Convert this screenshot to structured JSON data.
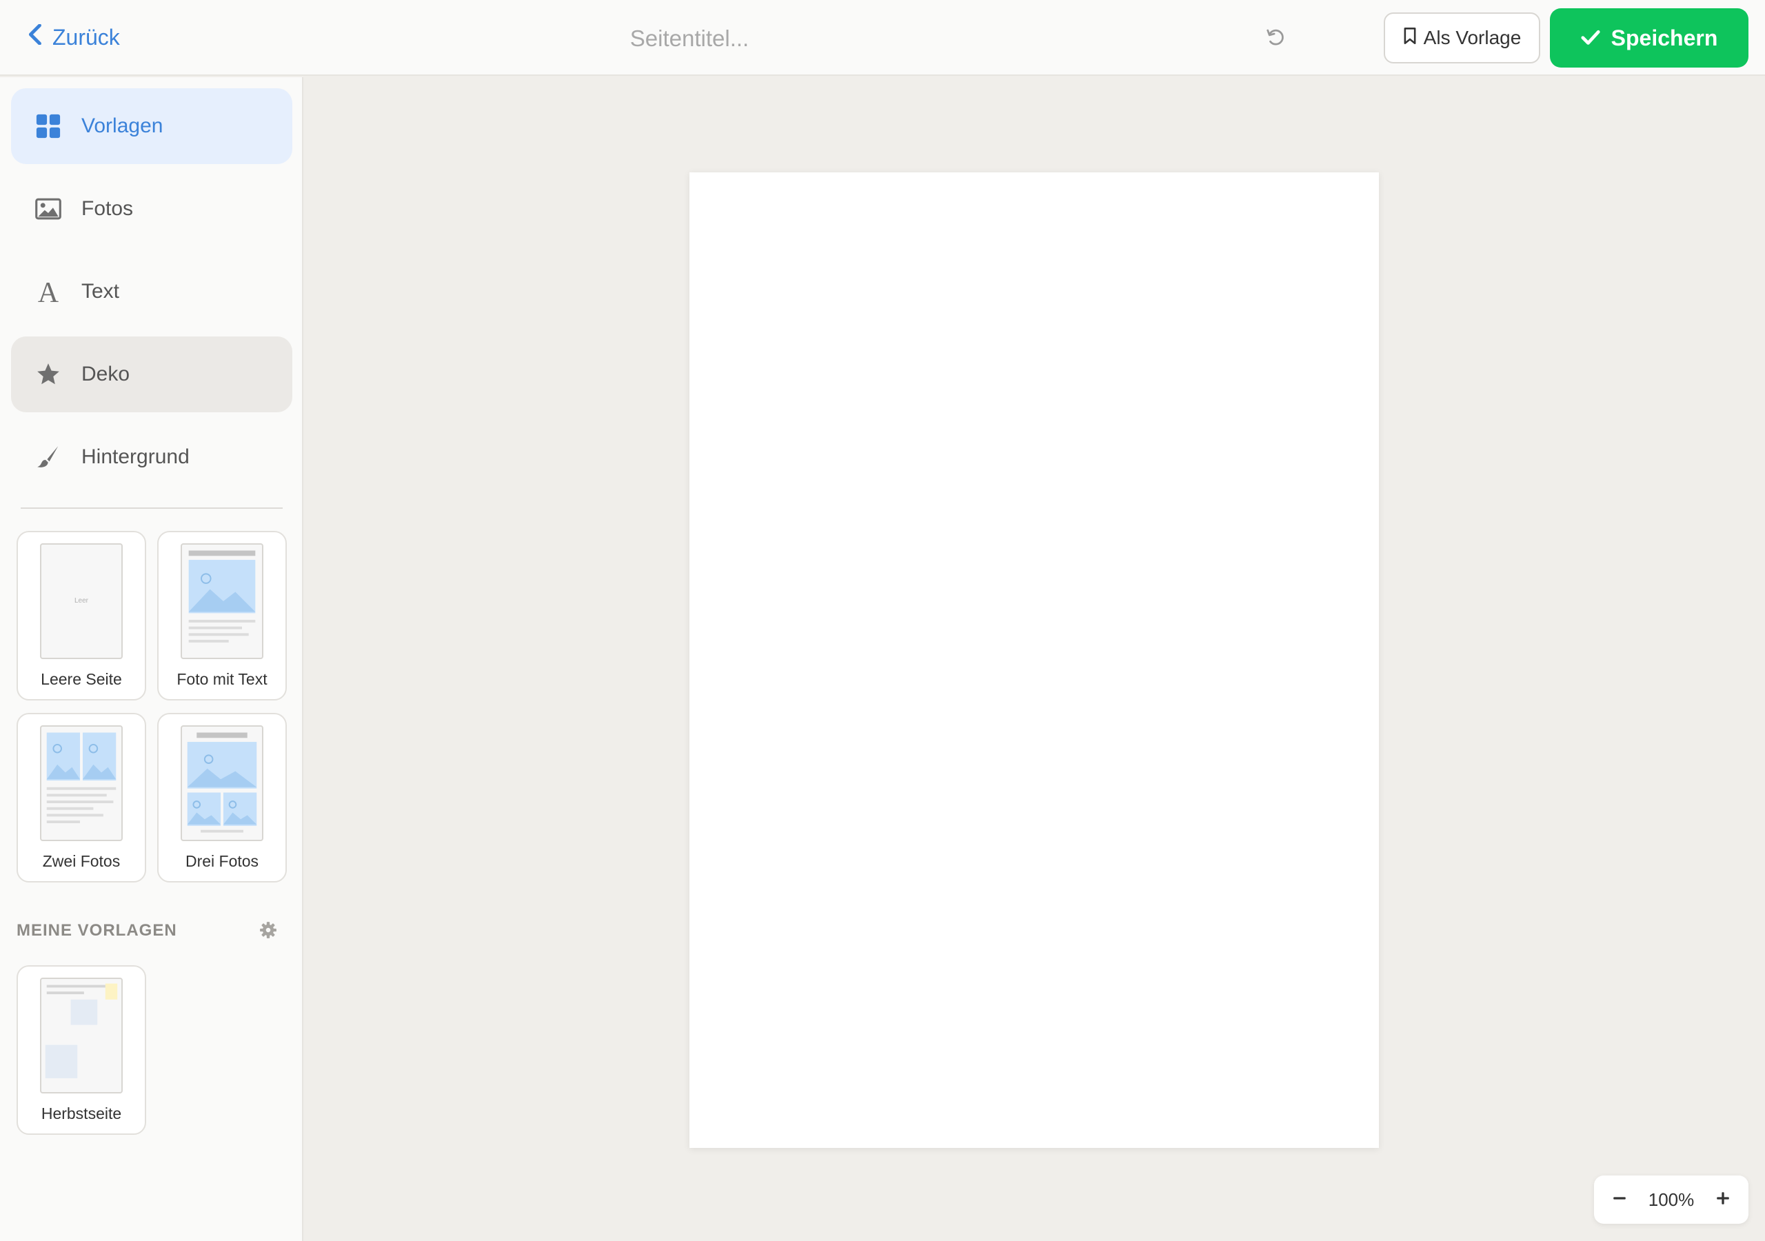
{
  "header": {
    "back_label": "Zurück",
    "title_placeholder": "Seitentitel...",
    "template_button_label": "Als Vorlage",
    "save_button_label": "Speichern"
  },
  "sidebar": {
    "nav": [
      {
        "label": "Vorlagen",
        "icon": "grid-icon",
        "active": true
      },
      {
        "label": "Fotos",
        "icon": "image-icon"
      },
      {
        "label": "Text",
        "icon": "text-icon"
      },
      {
        "label": "Deko",
        "icon": "star-icon"
      },
      {
        "label": "Hintergrund",
        "icon": "brush-icon"
      }
    ],
    "templates": [
      {
        "label": "Leere Seite",
        "thumb_text": "Leer"
      },
      {
        "label": "Foto mit Text"
      },
      {
        "label": "Zwei Fotos"
      },
      {
        "label": "Drei Fotos"
      }
    ],
    "my_templates_title": "MEINE VORLAGEN",
    "my_templates": [
      {
        "label": "Herbstseite"
      }
    ]
  },
  "zoom": {
    "value": "100%"
  },
  "colors": {
    "accent": "#3b82d9",
    "save_green": "#0ec45c",
    "active_nav_bg": "#e6effd",
    "canvas_bg": "#f0eeea"
  }
}
